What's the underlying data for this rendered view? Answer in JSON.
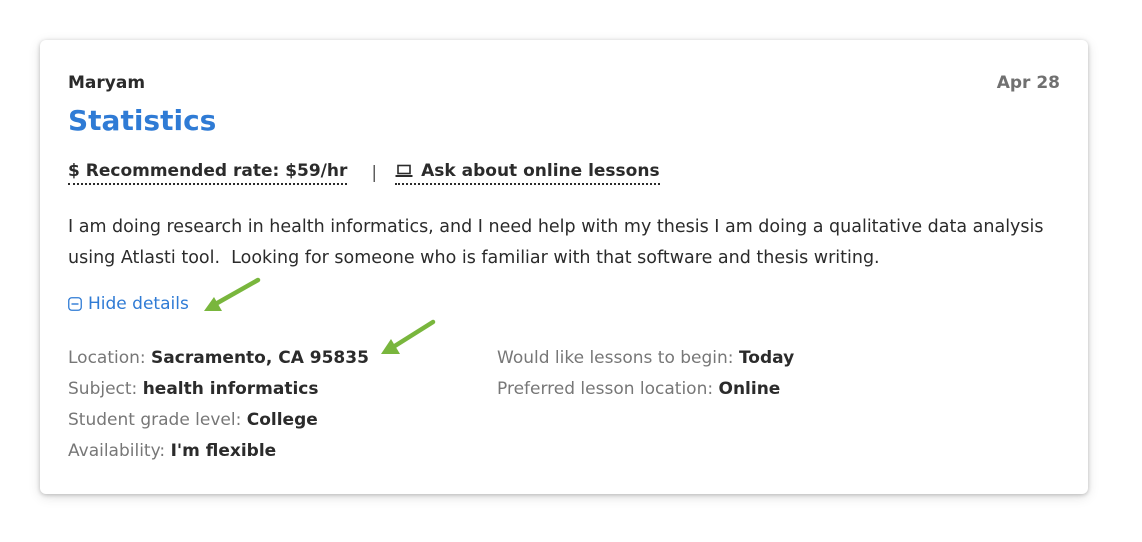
{
  "request": {
    "student_name": "Maryam",
    "date": "Apr 28",
    "subject_title": "Statistics",
    "rate_label": "$ Recommended rate: $59/hr",
    "separator": "|",
    "online_label": "Ask about online lessons",
    "description": "I am doing research in health informatics, and I need help with my thesis I am doing a qualitative data analysis using Atlasti tool.  Looking for someone who is familiar with that software and thesis writing.",
    "hide_details_label": "Hide details"
  },
  "details": {
    "left": [
      {
        "label": "Location: ",
        "value": "Sacramento, CA 95835"
      },
      {
        "label": "Subject: ",
        "value": "health informatics"
      },
      {
        "label": "Student grade level: ",
        "value": "College"
      },
      {
        "label": "Availability: ",
        "value": "I'm flexible"
      }
    ],
    "right": [
      {
        "label": "Would like lessons to begin: ",
        "value": "Today"
      },
      {
        "label": "Preferred lesson location: ",
        "value": "Online"
      }
    ]
  },
  "icons": {
    "online": "laptop-icon",
    "hide_details": "minus-square-icon",
    "annotations": "green-arrow-icon"
  },
  "colors": {
    "accent": "#2f7bd5",
    "annotation_arrow": "#79b63d",
    "label_gray": "#777777",
    "text": "#2b2b2b"
  }
}
